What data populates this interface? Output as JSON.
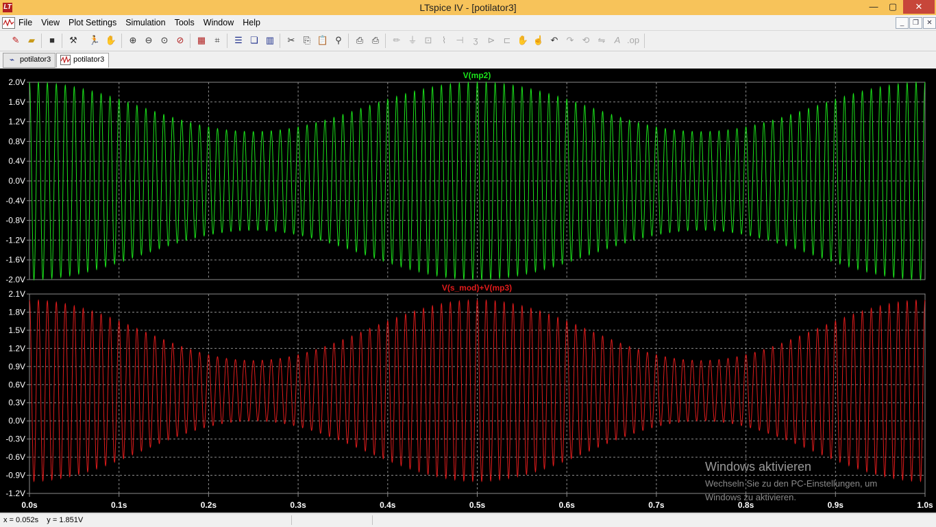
{
  "window": {
    "title": "LTspice IV - [potilator3]",
    "app_icon": "LT",
    "controls": {
      "minimize": "—",
      "maximize": "▢",
      "close": "✕"
    }
  },
  "menu": {
    "items": [
      "File",
      "View",
      "Plot Settings",
      "Simulation",
      "Tools",
      "Window",
      "Help"
    ],
    "mdi_controls": {
      "minimize": "_",
      "restore": "❐",
      "close": "✕"
    }
  },
  "toolbar": {
    "icons": [
      "new-schematic-icon",
      "open-icon",
      "save-icon",
      "control-panel-icon",
      "run-icon",
      "halt-icon",
      "zoom-in-icon",
      "zoom-out-icon",
      "zoom-fit-icon",
      "zoom-cancel-icon",
      "autorange-icon",
      "mark-unused-icon",
      "tile-horizontal-icon",
      "cascade-icon",
      "tile-vertical-icon",
      "cut-icon",
      "copy-icon",
      "paste-icon",
      "find-icon",
      "print-setup-icon",
      "print-icon",
      "wire-icon",
      "ground-icon",
      "label-net-icon",
      "resistor-icon",
      "capacitor-icon",
      "inductor-icon",
      "diode-icon",
      "component-icon",
      "move-icon",
      "drag-icon",
      "undo-icon",
      "redo-icon",
      "rotate-icon",
      "mirror-icon",
      "text-icon",
      "spice-directive-icon"
    ]
  },
  "tabs": [
    {
      "label": "potilator3",
      "icon": "schematic-icon",
      "active": false
    },
    {
      "label": "potilator3",
      "icon": "waveform-icon",
      "active": true
    }
  ],
  "colors": {
    "trace_top": "#1be31b",
    "trace_bottom": "#e01b1b",
    "grid": "#8c8c8c",
    "axis_text": "#ffffff",
    "background": "#000000"
  },
  "chart_data": [
    {
      "type": "line",
      "title": "V(mp2)",
      "x_range": [
        0,
        1
      ],
      "ylim": [
        -2.0,
        2.0
      ],
      "x_ticks": [
        "0.0s",
        "0.1s",
        "0.2s",
        "0.3s",
        "0.4s",
        "0.5s",
        "0.6s",
        "0.7s",
        "0.8s",
        "0.9s",
        "1.0s"
      ],
      "y_ticks": [
        "2.0V",
        "1.6V",
        "1.2V",
        "0.8V",
        "0.4V",
        "0.0V",
        "-0.4V",
        "-0.8V",
        "-1.2V",
        "-1.6V",
        "-2.0V"
      ],
      "y_tick_values": [
        2.0,
        1.6,
        1.2,
        0.8,
        0.4,
        0.0,
        -0.4,
        -0.8,
        -1.2,
        -1.6,
        -2.0
      ],
      "carrier_cycles": 100,
      "envelope_period_s": 0.5,
      "envelope_max": 2.0,
      "envelope_min": 1.0,
      "envelope_at_max_x": [
        0.0,
        0.5,
        1.0
      ],
      "envelope_at_min_x": [
        0.25,
        0.75
      ],
      "grid": true
    },
    {
      "type": "line",
      "title": "V(s_mod)+V(mp3)",
      "x_range": [
        0,
        1
      ],
      "ylim": [
        -1.2,
        2.1
      ],
      "x_ticks": [
        "0.0s",
        "0.1s",
        "0.2s",
        "0.3s",
        "0.4s",
        "0.5s",
        "0.6s",
        "0.7s",
        "0.8s",
        "0.9s",
        "1.0s"
      ],
      "y_ticks": [
        "2.1V",
        "1.8V",
        "1.5V",
        "1.2V",
        "0.9V",
        "0.6V",
        "0.3V",
        "0.0V",
        "-0.3V",
        "-0.6V",
        "-0.9V",
        "-1.2V"
      ],
      "y_tick_values": [
        2.1,
        1.8,
        1.5,
        1.2,
        0.9,
        0.6,
        0.3,
        0.0,
        -0.3,
        -0.6,
        -0.9,
        -1.2
      ],
      "carrier_cycles": 100,
      "envelope_period_s": 0.5,
      "offset_peak": 0.5,
      "amplitude_peak": 1.5,
      "offset_trough": 0.5,
      "amplitude_trough": 0.5,
      "grid": true
    }
  ],
  "status": {
    "readout": "x = 0.052s    y = 1.851V"
  },
  "watermark": {
    "heading": "Windows aktivieren",
    "line1": "Wechseln Sie zu den PC-Einstellungen, um",
    "line2": "Windows zu aktivieren."
  }
}
